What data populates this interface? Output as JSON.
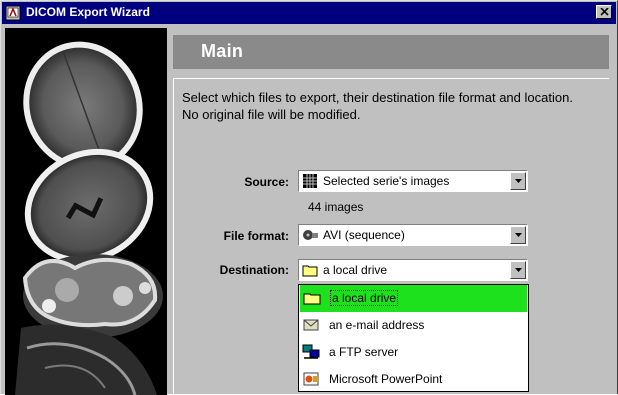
{
  "window": {
    "title": "DICOM Export Wizard"
  },
  "header": {
    "title": "Main"
  },
  "description": "Select which files to export, their destination file format and location. No original file will be modified.",
  "source": {
    "label": "Source:",
    "value": "Selected serie's images",
    "icon": "image-grid-icon",
    "count_text": "44 images"
  },
  "file_format": {
    "label": "File format:",
    "value": "AVI (sequence)",
    "icon": "film-reel-icon"
  },
  "destination": {
    "label": "Destination:",
    "value": "a local drive",
    "icon": "folder-icon",
    "options": [
      {
        "label": "a local drive",
        "icon": "folder-icon",
        "selected": true
      },
      {
        "label": "an e-mail address",
        "icon": "envelope-icon",
        "selected": false
      },
      {
        "label": "a FTP server",
        "icon": "network-computer-icon",
        "selected": false
      },
      {
        "label": "Microsoft PowerPoint",
        "icon": "powerpoint-icon",
        "selected": false
      }
    ]
  },
  "colors": {
    "title_bar": "#00007f",
    "header_bar": "#8a8a8a",
    "selection": "#1ee11e",
    "dialog": "#c0c0c0"
  }
}
